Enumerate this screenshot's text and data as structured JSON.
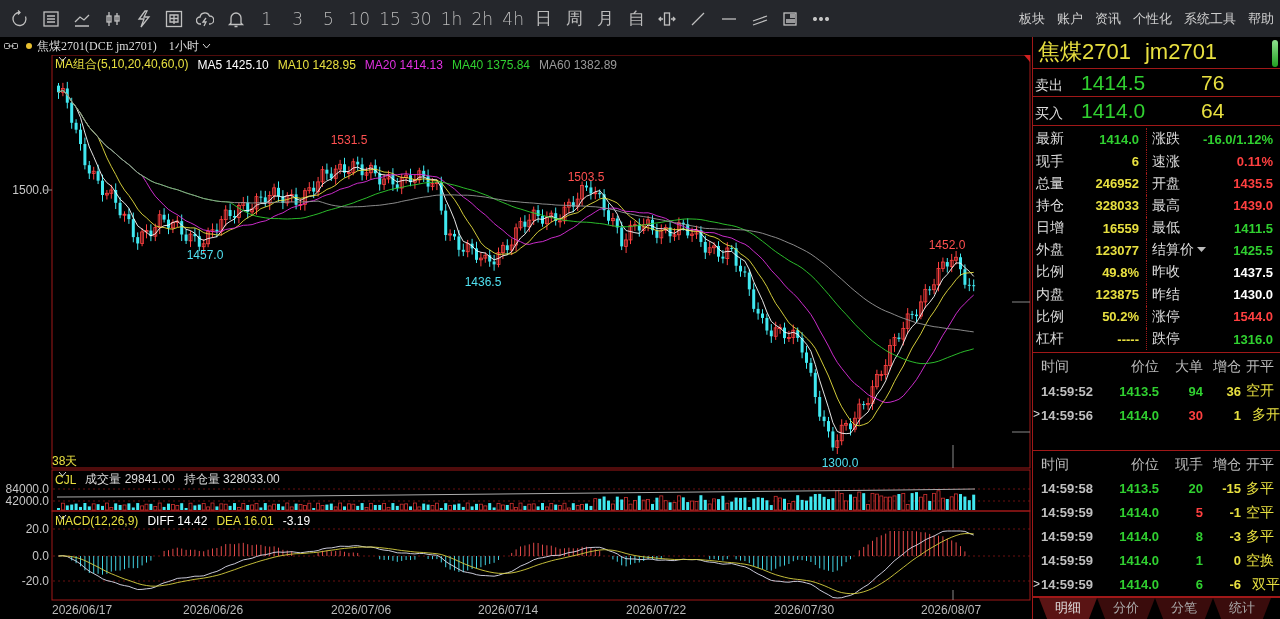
{
  "toolbar": {
    "periods": [
      "1",
      "3",
      "5",
      "10",
      "15",
      "30",
      "1h",
      "2h",
      "4h",
      "日",
      "周",
      "月",
      "自"
    ],
    "menu": [
      "板块",
      "账户",
      "资讯",
      "个性化",
      "系统工具",
      "帮助"
    ]
  },
  "instrument_bar": {
    "title": "焦煤2701(DCE jm2701)",
    "period": "1小时"
  },
  "price_chart": {
    "indicator": "MA组合(5,10,20,40,60,0)",
    "moving_averages": [
      {
        "text": "MA5 1425.10",
        "color": "#ffffff"
      },
      {
        "text": "MA10 1428.95",
        "color": "#e8e040"
      },
      {
        "text": "MA20 1414.13",
        "color": "#e030e0"
      },
      {
        "text": "MA40 1375.84",
        "color": "#30d030"
      },
      {
        "text": "MA60 1382.89",
        "color": "#9a9a9a"
      }
    ],
    "y_labels": [
      "1500.0"
    ],
    "price_labels": [
      {
        "text": "1457.0",
        "color": "#50e0f0"
      },
      {
        "text": "1531.5",
        "color": "#ff5050"
      },
      {
        "text": "1436.5",
        "color": "#50e0f0"
      },
      {
        "text": "1503.5",
        "color": "#ff5050"
      },
      {
        "text": "1300.0",
        "color": "#50e0f0"
      },
      {
        "text": "1452.0",
        "color": "#ff5050"
      }
    ],
    "bar_count": "38天"
  },
  "volume_panel": {
    "indicator": "CJL",
    "readings": [
      "成交量 29841.00",
      "持仓量 328033.00"
    ],
    "y_labels": [
      "84000.0",
      "42000.0"
    ]
  },
  "macd_panel": {
    "indicator": "MACD(12,26,9)",
    "readings": [
      {
        "text": "DIFF 14.42",
        "color": "#ffffff"
      },
      {
        "text": "DEA 16.01",
        "color": "#e8e040"
      },
      {
        "text": "-3.19",
        "color": "#ffffff"
      }
    ],
    "y_labels": [
      "20.0",
      "0.0",
      "-20.0"
    ]
  },
  "date_axis": [
    "2026/06/17",
    "2026/06/26",
    "2026/07/06",
    "2026/07/14",
    "2026/07/22",
    "2026/07/30",
    "2026/08/07"
  ],
  "quote": {
    "name": "焦煤2701",
    "code": "jm2701",
    "ask": {
      "label": "卖出",
      "price": "1414.5",
      "volume": "76"
    },
    "bid": {
      "label": "买入",
      "price": "1414.0",
      "volume": "64"
    },
    "stats": [
      {
        "kind": "value",
        "label": "最新",
        "value": "1414.0",
        "color": "#30d030"
      },
      {
        "kind": "value",
        "label": "涨跌",
        "value": "-16.0/1.12%",
        "color": "#30d030"
      },
      {
        "kind": "value",
        "label": "现手",
        "value": "6",
        "color": "#e8e040"
      },
      {
        "kind": "value",
        "label": "速涨",
        "value": "0.11%",
        "color": "#ff4040"
      },
      {
        "kind": "value",
        "label": "总量",
        "value": "246952",
        "color": "#e8e040"
      },
      {
        "kind": "value",
        "label": "开盘",
        "value": "1435.5",
        "color": "#ff4040"
      },
      {
        "kind": "value",
        "label": "持仓",
        "value": "328033",
        "color": "#e8e040"
      },
      {
        "kind": "value",
        "label": "最高",
        "value": "1439.0",
        "color": "#ff4040"
      },
      {
        "kind": "value",
        "label": "日增",
        "value": "16559",
        "color": "#e8e040"
      },
      {
        "kind": "value",
        "label": "最低",
        "value": "1411.5",
        "color": "#30d030"
      },
      {
        "kind": "value",
        "label": "外盘",
        "value": "123077",
        "color": "#e8e040"
      },
      {
        "kind": "menu",
        "label": "结算价",
        "value": "1425.5",
        "color": "#30d030"
      },
      {
        "kind": "value",
        "label": "比例",
        "value": "49.8%",
        "color": "#e8e040"
      },
      {
        "kind": "value",
        "label": "昨收",
        "value": "1437.5",
        "color": "#ffffff"
      },
      {
        "kind": "value",
        "label": "内盘",
        "value": "123875",
        "color": "#e8e040"
      },
      {
        "kind": "value",
        "label": "昨结",
        "value": "1430.0",
        "color": "#ffffff"
      },
      {
        "kind": "value",
        "label": "比例",
        "value": "50.2%",
        "color": "#e8e040"
      },
      {
        "kind": "value",
        "label": "涨停",
        "value": "1544.0",
        "color": "#ff4040"
      },
      {
        "kind": "value",
        "label": "杠杆",
        "value": "-----",
        "color": "#e8e040"
      },
      {
        "kind": "value",
        "label": "跌停",
        "value": "1316.0",
        "color": "#30d030"
      }
    ],
    "big_orders": {
      "columns": [
        "时间",
        "价位",
        "大单",
        "增仓",
        "开平"
      ],
      "rows": [
        {
          "time": "14:59:52",
          "price": "1413.5",
          "volume": "94",
          "color": "#30d030",
          "change": "36",
          "type": "空开"
        },
        {
          "marker": ">",
          "time": "14:59:56",
          "price": "1414.0",
          "volume": "30",
          "color": "#ff4040",
          "change": "1",
          "type": "多开"
        }
      ]
    },
    "ticks": {
      "columns": [
        "时间",
        "价位",
        "现手",
        "增仓",
        "开平"
      ],
      "rows": [
        {
          "time": "14:59:58",
          "price": "1413.5",
          "volume": "20",
          "color": "#30d030",
          "change": "-15",
          "type": "多平"
        },
        {
          "time": "14:59:59",
          "price": "1414.0",
          "volume": "5",
          "color": "#ff4040",
          "change": "-1",
          "type": "空平"
        },
        {
          "time": "14:59:59",
          "price": "1414.0",
          "volume": "8",
          "color": "#30d030",
          "change": "-3",
          "type": "多平"
        },
        {
          "time": "14:59:59",
          "price": "1414.0",
          "volume": "1",
          "color": "#30d030",
          "change": "0",
          "type": "空换"
        },
        {
          "marker": ">",
          "time": "14:59:59",
          "price": "1414.0",
          "volume": "6",
          "color": "#30d030",
          "change": "-6",
          "type": "双平"
        }
      ]
    },
    "tabs": [
      {
        "label": "明细",
        "selected": true
      },
      {
        "label": "分价",
        "selected": false
      },
      {
        "label": "分笔",
        "selected": false
      },
      {
        "label": "统计",
        "selected": false
      }
    ]
  }
}
